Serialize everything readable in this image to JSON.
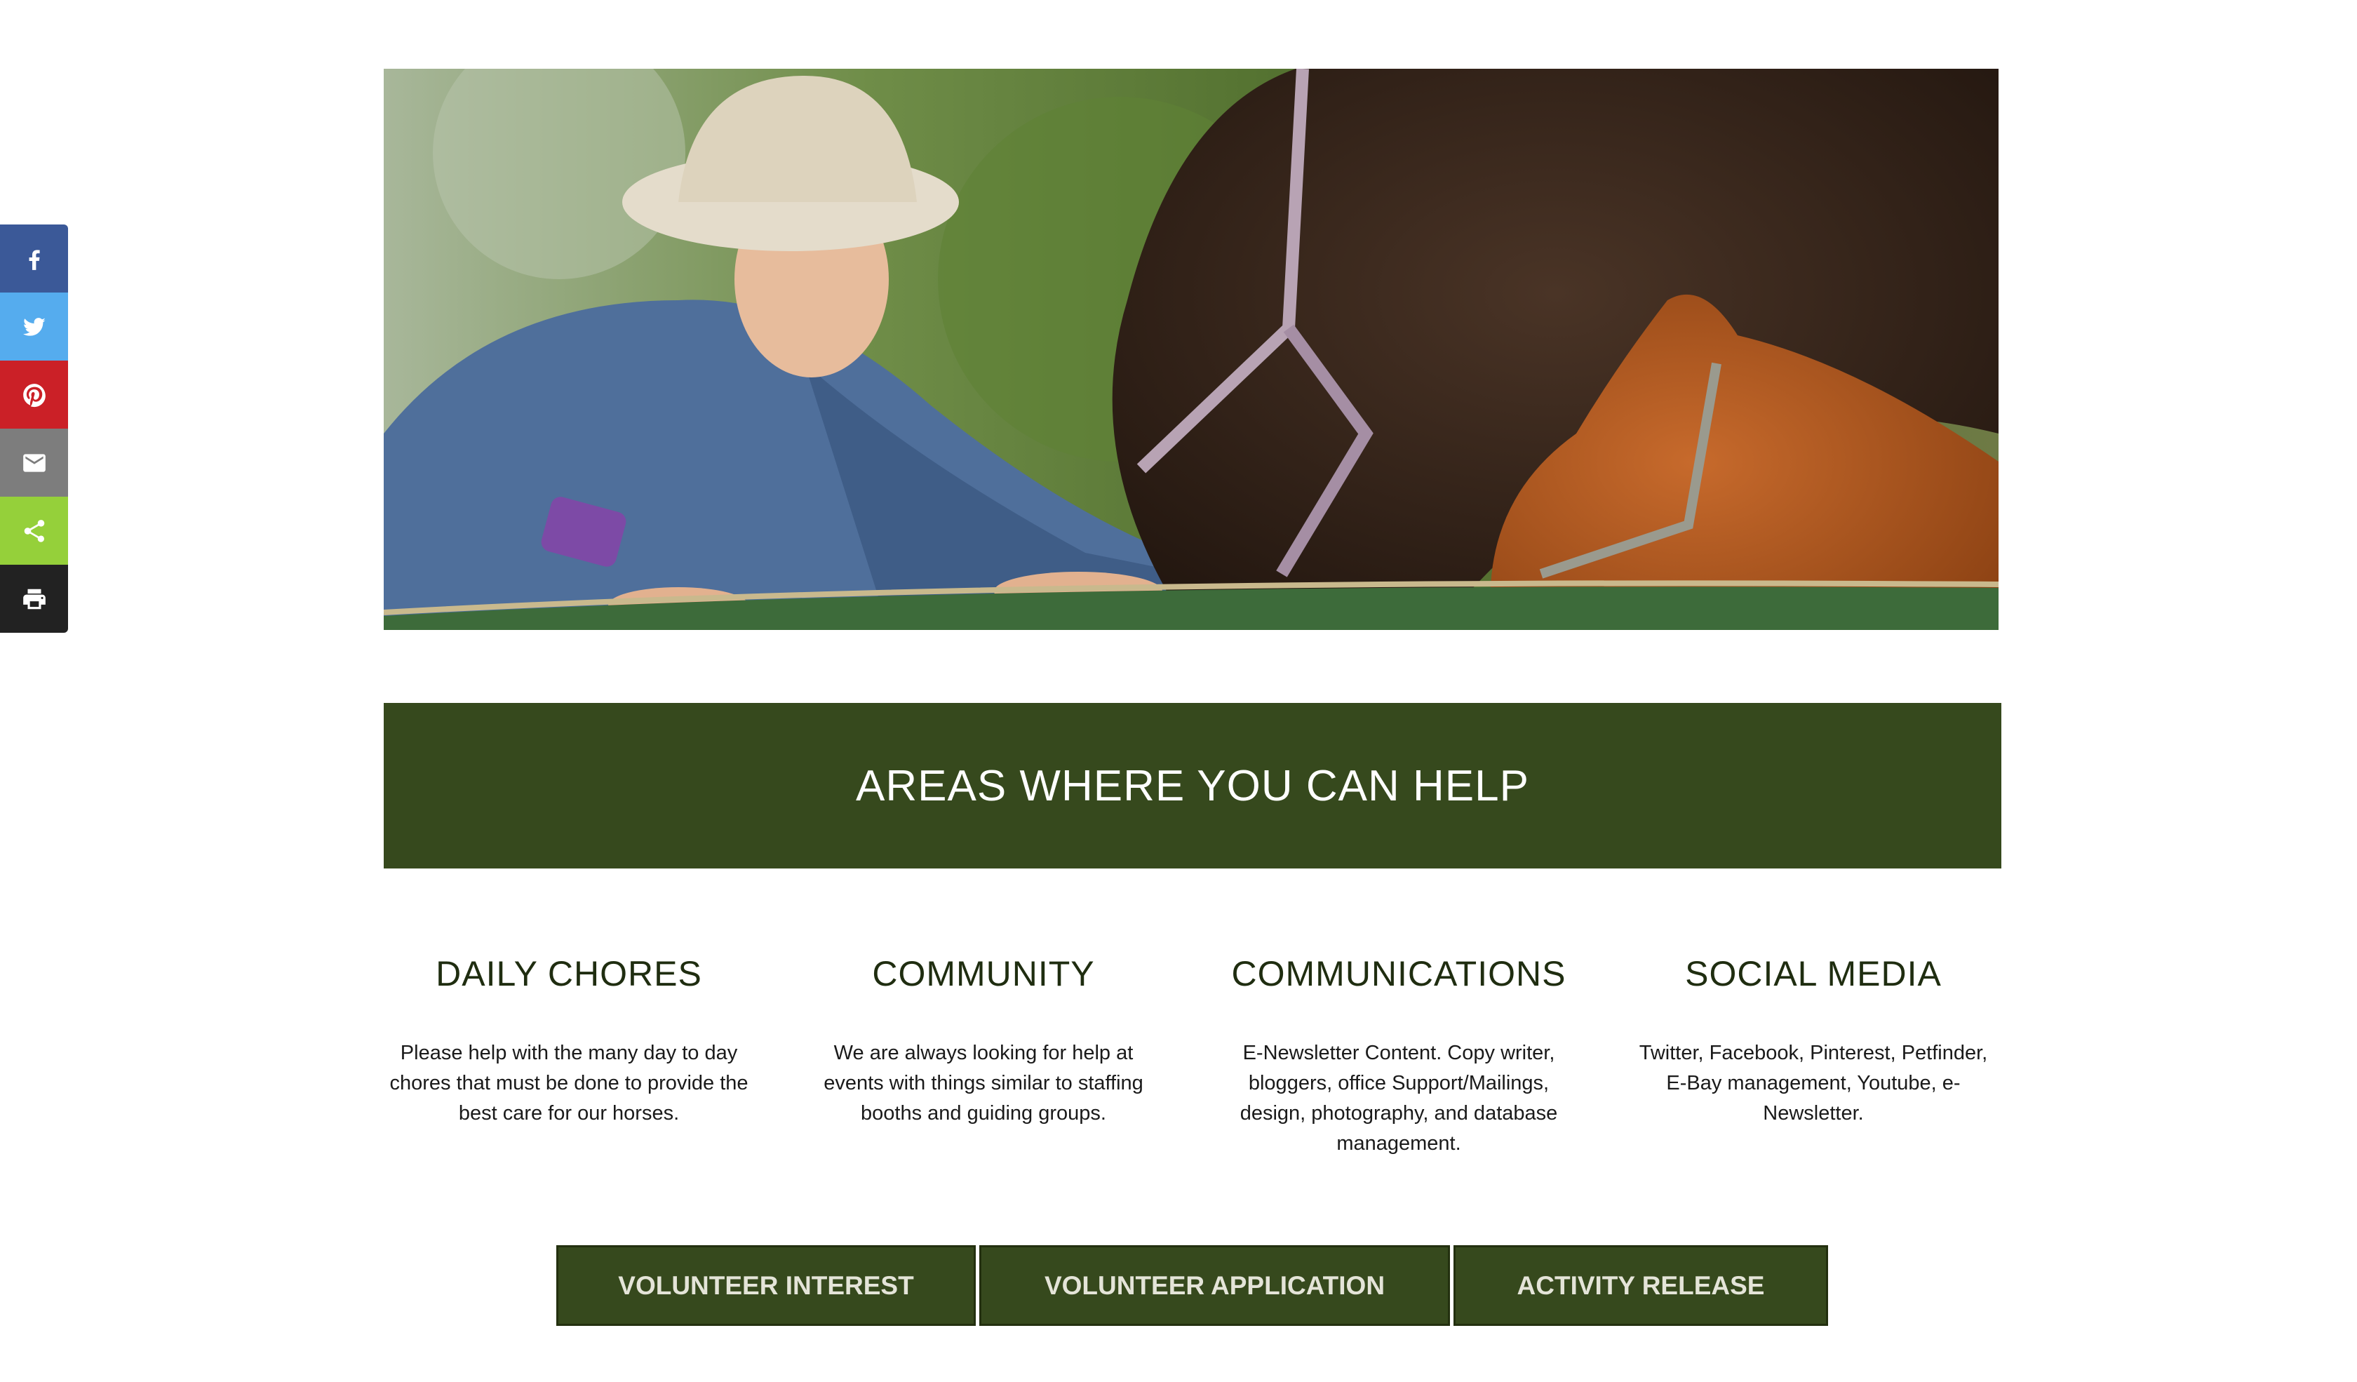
{
  "share": {
    "items": [
      {
        "name": "facebook",
        "icon": "facebook-icon",
        "color": "#3b5998"
      },
      {
        "name": "twitter",
        "icon": "twitter-icon",
        "color": "#55acee"
      },
      {
        "name": "pinterest",
        "icon": "pinterest-icon",
        "color": "#cb2027"
      },
      {
        "name": "email",
        "icon": "email-icon",
        "color": "#7d7d7d"
      },
      {
        "name": "share",
        "icon": "share-icon",
        "color": "#95d03a"
      },
      {
        "name": "print",
        "icon": "print-icon",
        "color": "#222222"
      }
    ]
  },
  "hero": {
    "image": "woman-with-horses-photo"
  },
  "banner": {
    "title": "AREAS WHERE YOU CAN HELP",
    "color": "#36491d"
  },
  "areas": [
    {
      "heading": "DAILY CHORES",
      "text": "Please help with the many day to day chores that must be done to provide the best care for our horses."
    },
    {
      "heading": "COMMUNITY",
      "text": "We are always looking for help at events with things similar to staffing booths and guiding groups."
    },
    {
      "heading": "COMMUNICATIONS",
      "text": "E-Newsletter Content. Copy writer, bloggers, office Support/Mailings, design, photography, and database management."
    },
    {
      "heading": "SOCIAL MEDIA",
      "text": "Twitter, Facebook, Pinterest, Petfinder, E-Bay management, Youtube, e-Newsletter."
    }
  ],
  "buttons": {
    "volunteer_interest": "VOLUNTEER INTEREST",
    "volunteer_application": "VOLUNTEER APPLICATION",
    "activity_release": "ACTIVITY RELEASE"
  }
}
